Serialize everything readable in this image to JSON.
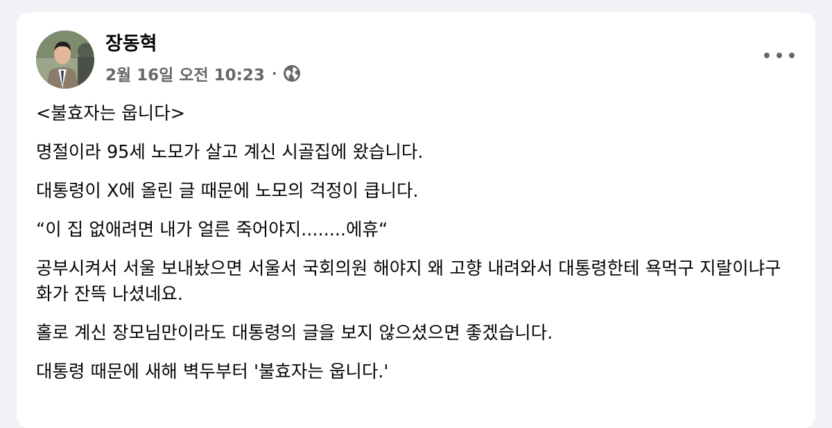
{
  "post": {
    "author": "장동혁",
    "date": "2월 16일 오전 10:23",
    "separator": "·",
    "privacy_icon": "globe-icon",
    "more_icon": "more-options-icon",
    "paragraphs": [
      "<불효자는 웁니다>",
      "명절이라 95세 노모가 살고 계신 시골집에 왔습니다.",
      "대통령이 X에 올린 글 때문에 노모의 걱정이 큽니다.",
      "“이 집 없애려면 내가 얼른 죽어야지........에휴“",
      "공부시켜서 서울 보내놨으면 서울서 국회의원 해야지 왜 고향 내려와서 대통령한테 욕먹구 지랄이냐구 화가 잔뜩 나셨네요.",
      "홀로 계신 장모님만이라도 대통령의 글을 보지 않으셨으면 좋겠습니다.",
      "대통령 때문에 새해 벽두부터 '불효자는 웁니다.'"
    ]
  },
  "colors": {
    "background": "#f0f2f5",
    "card": "#ffffff",
    "text": "#050505",
    "secondary": "#65676b"
  }
}
